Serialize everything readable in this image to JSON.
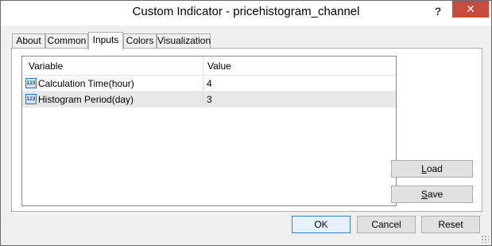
{
  "window": {
    "title": "Custom Indicator - pricehistogram_channel",
    "help_glyph": "?",
    "close_glyph": "✕"
  },
  "tabs": [
    {
      "label": "About"
    },
    {
      "label": "Common"
    },
    {
      "label": "Inputs",
      "active": true
    },
    {
      "label": "Colors"
    },
    {
      "label": "Visualization"
    }
  ],
  "grid": {
    "columns": [
      "Variable",
      "Value"
    ],
    "rows": [
      {
        "icon": "123",
        "variable": "Calculation Time(hour)",
        "value": "4"
      },
      {
        "icon": "123",
        "variable": "Histogram Period(day)",
        "value": "3"
      }
    ]
  },
  "side_buttons": {
    "load_first": "L",
    "load_rest": "oad",
    "save_first": "S",
    "save_rest": "ave"
  },
  "footer": {
    "ok": "OK",
    "cancel": "Cancel",
    "reset": "Reset"
  },
  "colors": {
    "close_button": "#c74c3c",
    "default_button_border": "#3c7fb1"
  }
}
